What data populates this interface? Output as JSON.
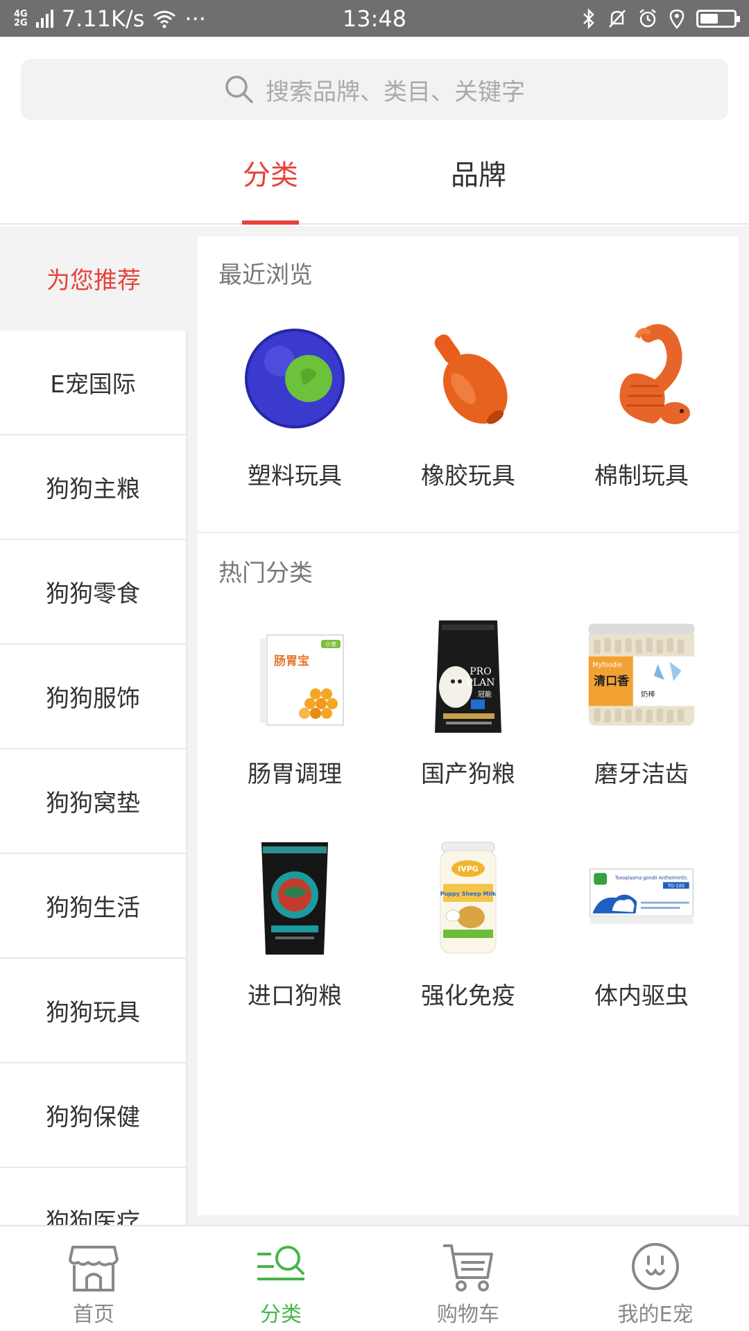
{
  "status_bar": {
    "network": "4G\n2G",
    "net_top": "4G",
    "net_bottom": "2G",
    "speed": "7.11K/s",
    "dots": "···",
    "time": "13:48",
    "battery_level": 0.55
  },
  "search": {
    "placeholder": "搜索品牌、类目、关键字"
  },
  "tabs": [
    {
      "label": "分类",
      "active": true
    },
    {
      "label": "品牌",
      "active": false
    }
  ],
  "sidebar": {
    "items": [
      {
        "label": "为您推荐",
        "active": true
      },
      {
        "label": "E宠国际"
      },
      {
        "label": "狗狗主粮"
      },
      {
        "label": "狗狗零食"
      },
      {
        "label": "狗狗服饰"
      },
      {
        "label": "狗狗窝垫"
      },
      {
        "label": "狗狗生活"
      },
      {
        "label": "狗狗玩具"
      },
      {
        "label": "狗狗保健"
      },
      {
        "label": "狗狗医疗"
      }
    ]
  },
  "recent": {
    "title": "最近浏览",
    "items": [
      {
        "label": "塑料玩具",
        "icon": "plastic-ball-toy"
      },
      {
        "label": "橡胶玩具",
        "icon": "rubber-toy"
      },
      {
        "label": "棉制玩具",
        "icon": "rope-squirrel-toy"
      }
    ]
  },
  "hot": {
    "title": "热门分类",
    "items": [
      {
        "label": "肠胃调理",
        "icon": "probiotic-box"
      },
      {
        "label": "国产狗粮",
        "icon": "proplan-food-bag"
      },
      {
        "label": "磨牙洁齿",
        "icon": "dental-sticks-jar"
      },
      {
        "label": "进口狗粮",
        "icon": "imported-food-bag"
      },
      {
        "label": "强化免疫",
        "icon": "goat-milk-can"
      },
      {
        "label": "体内驱虫",
        "icon": "dewormer-box"
      }
    ]
  },
  "product_text": {
    "probiotic_brand": "小宠",
    "probiotic_name": "肠胃宝",
    "proplan_top": "PRO",
    "proplan_bottom": "PLAN",
    "proplan_cn": "冠能",
    "jar_brand": "Myfoodie",
    "jar_title": "清口香",
    "jar_sub": "奶棒",
    "can_brand": "IVPG",
    "can_name": "Puppy Sheep Milk",
    "dewormer_title": "Toxoplasma gondii Anthelmintic",
    "dewormer_code": "TG-100"
  },
  "bottom_nav": {
    "items": [
      {
        "label": "首页",
        "icon": "shop-icon"
      },
      {
        "label": "分类",
        "icon": "category-search-icon",
        "active": true
      },
      {
        "label": "购物车",
        "icon": "cart-icon"
      },
      {
        "label": "我的E宠",
        "icon": "pet-face-icon"
      }
    ]
  },
  "colors": {
    "accent": "#e8413a",
    "nav_active": "#44b649",
    "status_bar": "#6f6f6f"
  }
}
